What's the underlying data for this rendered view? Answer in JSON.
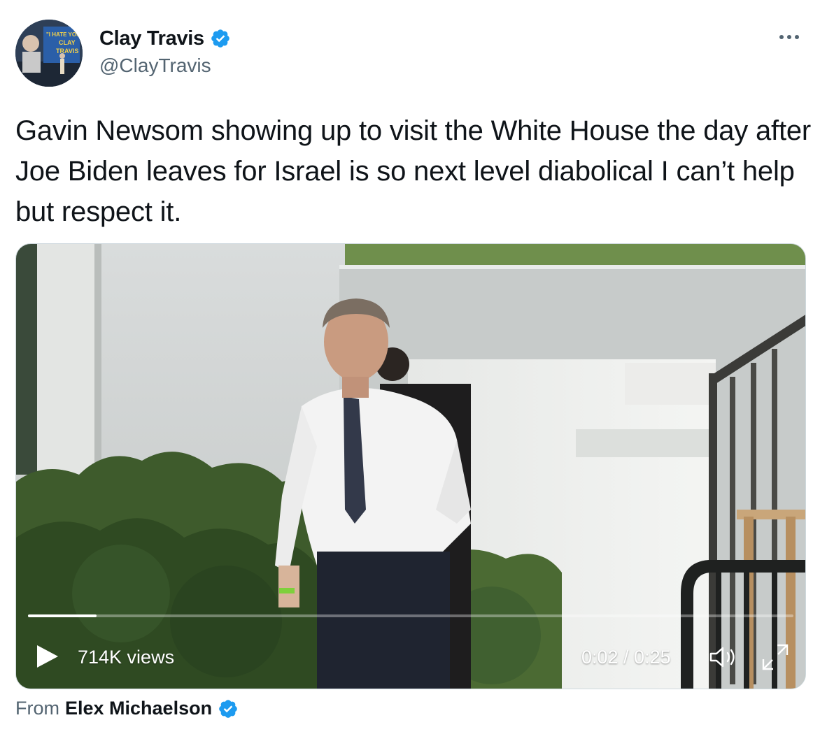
{
  "author": {
    "display_name": "Clay Travis",
    "handle": "@ClayTravis",
    "avatar_icon": "profile-photo-icon",
    "verified": true,
    "avatar_sign_text": "\"I HATE YOU CLAY TRAVIS\""
  },
  "tweet": {
    "text": "Gavin Newsom showing up to visit the White House the day after Joe Biden leaves for Israel is so next level diabolical I can’t help but respect it."
  },
  "video": {
    "views": "714K views",
    "time": "0:02 / 0:25",
    "progress": 0.09,
    "play_icon": "play-icon",
    "volume_icon": "volume-icon",
    "fullscreen_icon": "fullscreen-icon"
  },
  "attribution": {
    "from_label": "From",
    "source_name": "Elex Michaelson",
    "verified": true
  },
  "colors": {
    "verified_blue": "#1d9bf0",
    "text_primary": "#0f1419",
    "text_secondary": "#536471"
  }
}
